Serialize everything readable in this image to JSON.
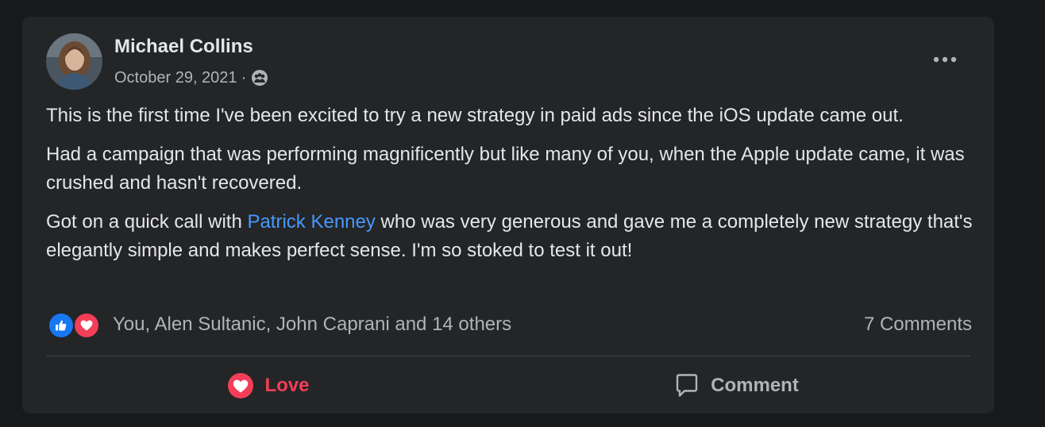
{
  "post": {
    "author": "Michael Collins",
    "date": "October 29, 2021",
    "separator": "·",
    "audience_icon": "group-icon",
    "paragraphs": [
      {
        "text": "This is the first time I've been excited to try a new strategy in paid ads since the iOS update came out."
      },
      {
        "text": "Had a campaign that was performing magnificently but like many of you, when the Apple update came, it was crushed and hasn't recovered."
      },
      {
        "before": "Got on a quick call with ",
        "mention": "Patrick Kenney",
        "after": " who was very generous and gave me a completely new strategy that's elegantly simple and makes perfect sense. I'm so stoked to test it out!"
      }
    ]
  },
  "reactions": {
    "icons": [
      "like-icon",
      "love-icon"
    ],
    "summary": "You, Alen Sultanic, John Caprani and 14 others",
    "comments": "7 Comments"
  },
  "actions": {
    "love_label": "Love",
    "comment_label": "Comment"
  },
  "colors": {
    "background": "#18191a",
    "card": "#242526",
    "primary_text": "#e4e6eb",
    "secondary_text": "#b0b3b8",
    "mention": "#4599ff",
    "love": "#f33e58",
    "like": "#1877f2"
  }
}
